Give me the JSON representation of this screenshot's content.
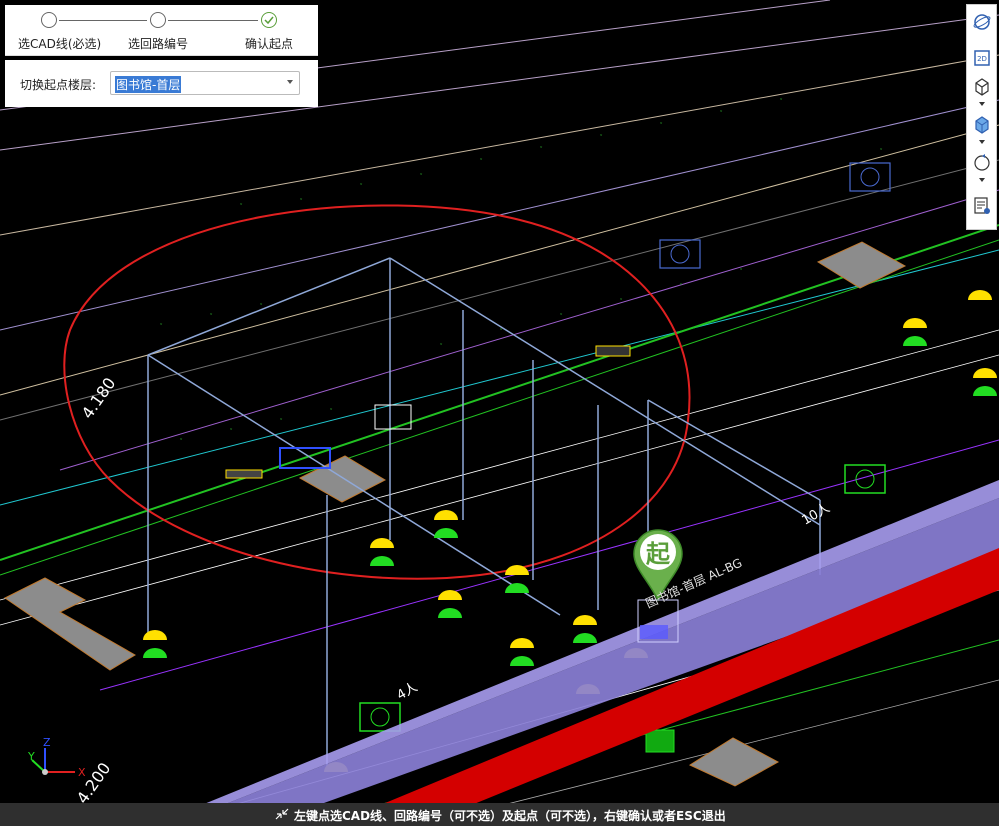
{
  "wizard": {
    "steps": [
      {
        "label": "选CAD线(必选)",
        "state": "pending"
      },
      {
        "label": "选回路编号",
        "state": "pending"
      },
      {
        "label": "确认起点",
        "state": "done"
      }
    ]
  },
  "floor_switch": {
    "label": "切换起点楼层:",
    "value": "图书馆-首层"
  },
  "toolbar": {
    "items": [
      "sphere-icon",
      "2d-view-icon",
      "cube-wireframe-icon",
      "cube-solid-icon",
      "rotate-icon",
      "properties-icon"
    ]
  },
  "viewport": {
    "start_marker": "起",
    "start_label": "图书馆-首层 AL-BG",
    "cad_texts": [
      "4.180",
      "4.200",
      "4人",
      "10人"
    ],
    "axis_labels": {
      "x": "X",
      "y": "Y",
      "z": "Z"
    },
    "colors": {
      "background": "#000000",
      "selection_circle": "#e02020",
      "cable_tray": "#8a7fd6",
      "red_pipe": "#d40000",
      "wire_green": "#22c222",
      "structure_blue": "#8fa8d8"
    }
  },
  "status_bar": {
    "text": "左键点选CAD线、回路编号（可不选）及起点（可不选），右键确认或者ESC退出"
  }
}
